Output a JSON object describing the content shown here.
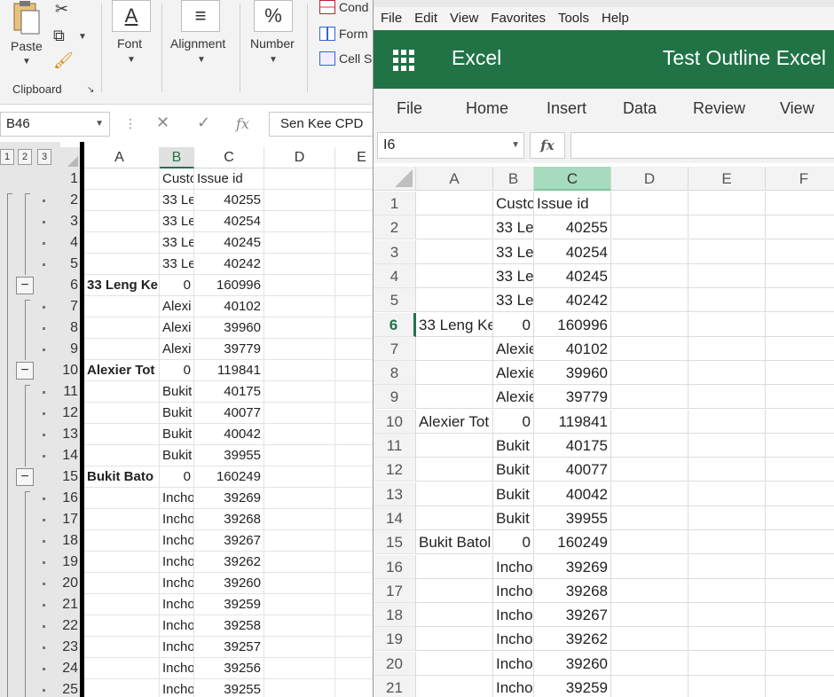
{
  "desktop": {
    "ribbon": {
      "paste_label": "Paste",
      "clipboard_label": "Clipboard",
      "font_label": "Font",
      "alignment_label": "Alignment",
      "number_label": "Number",
      "cond_label": "Cond",
      "form_label": "Form",
      "cell_label": "Cell S"
    },
    "name_box": "B46",
    "formula_value": "Sen Kee CPD",
    "outline_levels": [
      "1",
      "2",
      "3"
    ],
    "columns": [
      "A",
      "B",
      "C",
      "D",
      "E"
    ],
    "rows": [
      {
        "n": "1",
        "a": "",
        "b": "Custo",
        "c": "Issue id",
        "bold": false,
        "c_is_text": true
      },
      {
        "n": "2",
        "a": "",
        "b": "33 Le",
        "c": "40255",
        "bold": false
      },
      {
        "n": "3",
        "a": "",
        "b": "33 Le",
        "c": "40254",
        "bold": false
      },
      {
        "n": "4",
        "a": "",
        "b": "33 Le",
        "c": "40245",
        "bold": false
      },
      {
        "n": "5",
        "a": "",
        "b": "33 Le",
        "c": "40242",
        "bold": false
      },
      {
        "n": "6",
        "a": "33 Leng Ke",
        "b": "0",
        "c": "160996",
        "bold": true
      },
      {
        "n": "7",
        "a": "",
        "b": "Alexi",
        "c": "40102",
        "bold": false
      },
      {
        "n": "8",
        "a": "",
        "b": "Alexi",
        "c": "39960",
        "bold": false
      },
      {
        "n": "9",
        "a": "",
        "b": "Alexi",
        "c": "39779",
        "bold": false
      },
      {
        "n": "10",
        "a": "Alexier Tot",
        "b": "0",
        "c": "119841",
        "bold": true
      },
      {
        "n": "11",
        "a": "",
        "b": "Bukit",
        "c": "40175",
        "bold": false
      },
      {
        "n": "12",
        "a": "",
        "b": "Bukit",
        "c": "40077",
        "bold": false
      },
      {
        "n": "13",
        "a": "",
        "b": "Bukit",
        "c": "40042",
        "bold": false
      },
      {
        "n": "14",
        "a": "",
        "b": "Bukit",
        "c": "39955",
        "bold": false
      },
      {
        "n": "15",
        "a": "Bukit Bato",
        "b": "0",
        "c": "160249",
        "bold": true
      },
      {
        "n": "16",
        "a": "",
        "b": "Incho",
        "c": "39269",
        "bold": false
      },
      {
        "n": "17",
        "a": "",
        "b": "Incho",
        "c": "39268",
        "bold": false
      },
      {
        "n": "18",
        "a": "",
        "b": "Incho",
        "c": "39267",
        "bold": false
      },
      {
        "n": "19",
        "a": "",
        "b": "Incho",
        "c": "39262",
        "bold": false
      },
      {
        "n": "20",
        "a": "",
        "b": "Incho",
        "c": "39260",
        "bold": false
      },
      {
        "n": "21",
        "a": "",
        "b": "Incho",
        "c": "39259",
        "bold": false
      },
      {
        "n": "22",
        "a": "",
        "b": "Incho",
        "c": "39258",
        "bold": false
      },
      {
        "n": "23",
        "a": "",
        "b": "Incho",
        "c": "39257",
        "bold": false
      },
      {
        "n": "24",
        "a": "",
        "b": "Incho",
        "c": "39256",
        "bold": false
      },
      {
        "n": "25",
        "a": "",
        "b": "Incho",
        "c": "39255",
        "bold": false
      }
    ]
  },
  "web": {
    "menu": [
      "File",
      "Edit",
      "View",
      "Favorites",
      "Tools",
      "Help"
    ],
    "app_name": "Excel",
    "doc_title": "Test Outline Excel",
    "tabs": [
      "File",
      "Home",
      "Insert",
      "Data",
      "Review",
      "View"
    ],
    "name_box": "I6",
    "fx_label": "fx",
    "columns": [
      "A",
      "B",
      "C",
      "D",
      "E",
      "F"
    ],
    "rows": [
      {
        "n": "1",
        "a": "",
        "b": "Custo",
        "c": "Issue id",
        "c_is_text": true
      },
      {
        "n": "2",
        "a": "",
        "b": "33 Le",
        "c": "40255"
      },
      {
        "n": "3",
        "a": "",
        "b": "33 Le",
        "c": "40254"
      },
      {
        "n": "4",
        "a": "",
        "b": "33 Le",
        "c": "40245"
      },
      {
        "n": "5",
        "a": "",
        "b": "33 Le",
        "c": "40242"
      },
      {
        "n": "6",
        "a": "33 Leng Ke",
        "b": "0",
        "c": "160996"
      },
      {
        "n": "7",
        "a": "",
        "b": "Alexie",
        "c": "40102"
      },
      {
        "n": "8",
        "a": "",
        "b": "Alexie",
        "c": "39960"
      },
      {
        "n": "9",
        "a": "",
        "b": "Alexie",
        "c": "39779"
      },
      {
        "n": "10",
        "a": "Alexier Tot",
        "b": "0",
        "c": "119841"
      },
      {
        "n": "11",
        "a": "",
        "b": "Bukit",
        "c": "40175"
      },
      {
        "n": "12",
        "a": "",
        "b": "Bukit",
        "c": "40077"
      },
      {
        "n": "13",
        "a": "",
        "b": "Bukit",
        "c": "40042"
      },
      {
        "n": "14",
        "a": "",
        "b": "Bukit",
        "c": "39955"
      },
      {
        "n": "15",
        "a": "Bukit Batol",
        "b": "0",
        "c": "160249"
      },
      {
        "n": "16",
        "a": "",
        "b": "Incho",
        "c": "39269"
      },
      {
        "n": "17",
        "a": "",
        "b": "Incho",
        "c": "39268"
      },
      {
        "n": "18",
        "a": "",
        "b": "Incho",
        "c": "39267"
      },
      {
        "n": "19",
        "a": "",
        "b": "Incho",
        "c": "39262"
      },
      {
        "n": "20",
        "a": "",
        "b": "Incho",
        "c": "39260"
      },
      {
        "n": "21",
        "a": "",
        "b": "Incho",
        "c": "39259"
      }
    ]
  },
  "colors": {
    "excel_green": "#217346",
    "selected_col_web": "#a7dbbd"
  }
}
